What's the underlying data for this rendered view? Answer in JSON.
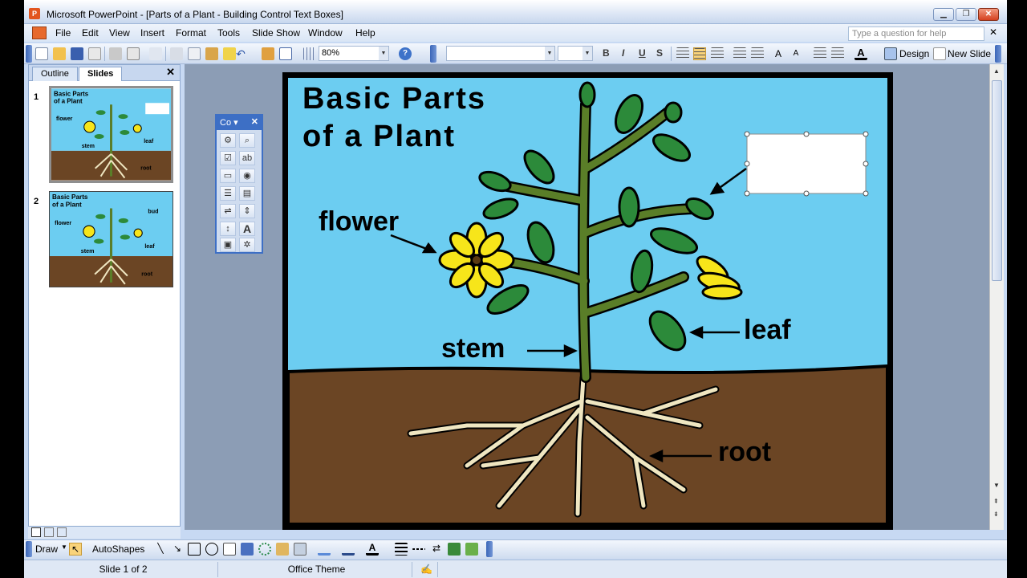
{
  "window": {
    "title": "Microsoft PowerPoint - [Parts of a Plant  - Building Control Text Boxes]",
    "app_icon_label": "P"
  },
  "menu": {
    "items": [
      "File",
      "Edit",
      "View",
      "Insert",
      "Format",
      "Tools",
      "Slide Show",
      "Window",
      "Help"
    ],
    "help_placeholder": "Type a question for help"
  },
  "toolbar": {
    "zoom": "80%",
    "format_buttons": [
      "B",
      "I",
      "U",
      "S"
    ],
    "design_label": "Design",
    "new_slide_label": "New Slide"
  },
  "panel": {
    "tabs": [
      "Outline",
      "Slides"
    ],
    "active_tab": "Slides",
    "thumbnails": [
      {
        "number": "1",
        "title_line1": "Basic Parts",
        "title_line2": "of a Plant",
        "labels": [
          "flower",
          "stem",
          "leaf",
          "root"
        ]
      },
      {
        "number": "2",
        "title_line1": "Basic Parts",
        "title_line2": "of a Plant",
        "labels": [
          "flower",
          "stem",
          "leaf",
          "root",
          "bud"
        ]
      }
    ]
  },
  "slide": {
    "title_line1": "Basic Parts",
    "title_line2": "of a Plant",
    "labels": {
      "flower": "flower",
      "stem": "stem",
      "leaf": "leaf",
      "root": "root"
    },
    "colors": {
      "sky": "#6ccdf1",
      "soil": "#6b4524",
      "stem": "#5a7e28",
      "leaf": "#2c8a3a",
      "petal": "#f7e51a",
      "root": "#efe6c1"
    }
  },
  "control_toolbox": {
    "title": "Co",
    "buttons": [
      "properties-icon",
      "view-code-icon",
      "checkbox-icon",
      "textbox-icon",
      "command-button-icon",
      "option-button-icon",
      "listbox-icon",
      "combobox-icon",
      "toggle-button-icon",
      "spin-button-icon",
      "scrollbar-icon",
      "label-icon",
      "image-icon",
      "more-controls-icon"
    ]
  },
  "drawing": {
    "draw_label": "Draw",
    "autoshapes_label": "AutoShapes"
  },
  "status": {
    "slide_position": "Slide 1 of 2",
    "theme": "Office Theme"
  }
}
